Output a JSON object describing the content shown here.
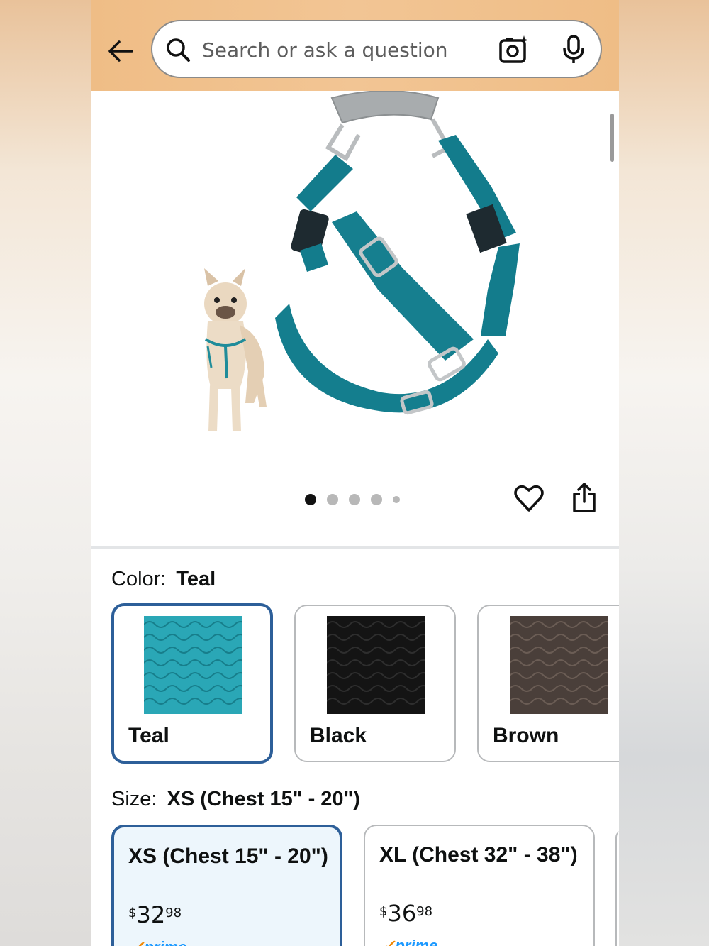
{
  "search": {
    "placeholder": "Search or ask a question"
  },
  "icons": {
    "back": "back-arrow-icon",
    "search": "search-icon",
    "camera": "camera-lens-icon",
    "mic": "microphone-icon",
    "heart": "heart-icon",
    "share": "share-icon"
  },
  "gallery": {
    "image_count": 5,
    "active_index": 0
  },
  "color": {
    "label": "Color:",
    "selected": "Teal",
    "options": [
      {
        "name": "Teal",
        "swatch": "#2aa7b6"
      },
      {
        "name": "Black",
        "swatch": "#141414"
      },
      {
        "name": "Brown",
        "swatch": "#4a3f3a"
      }
    ]
  },
  "size": {
    "label": "Size:",
    "selected": "XS (Chest 15\" - 20\")",
    "options": [
      {
        "name": "XS (Chest 15\" - 20\")",
        "currency": "$",
        "whole": "32",
        "fraction": "98",
        "prime": "prime"
      },
      {
        "name": "XL (Chest 32\" - 38\")",
        "currency": "$",
        "whole": "36",
        "fraction": "98",
        "prime": "prime"
      }
    ]
  },
  "colors": {
    "header_bg": "#f2c594",
    "selected_border": "#2d5f99",
    "harness_teal": "#137c8c",
    "prime_blue": "#1a98ff"
  }
}
